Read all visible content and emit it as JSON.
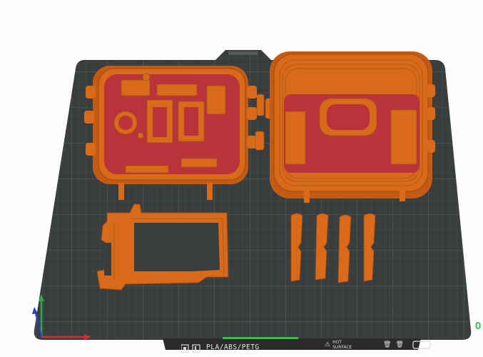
{
  "bed": {
    "material_label": "PLA/ABS/PETG",
    "hot_surface": [
      "HOT",
      "SURFACE"
    ],
    "plate_number": "0",
    "colors": {
      "plate": "#3a3d3d",
      "grid": "#4e5252",
      "part_orange": "#d86a1a",
      "part_top_red": "#b8343a",
      "axis_x": "#e0282a",
      "axis_y": "#2ea84a",
      "axis_z": "#2b3fbf"
    }
  },
  "icons": [
    "plate-settings-icon",
    "plate-grid-icon",
    "hot-surface-warning-icon",
    "trash-icon",
    "lock-icon",
    "delete-plate-icon"
  ]
}
